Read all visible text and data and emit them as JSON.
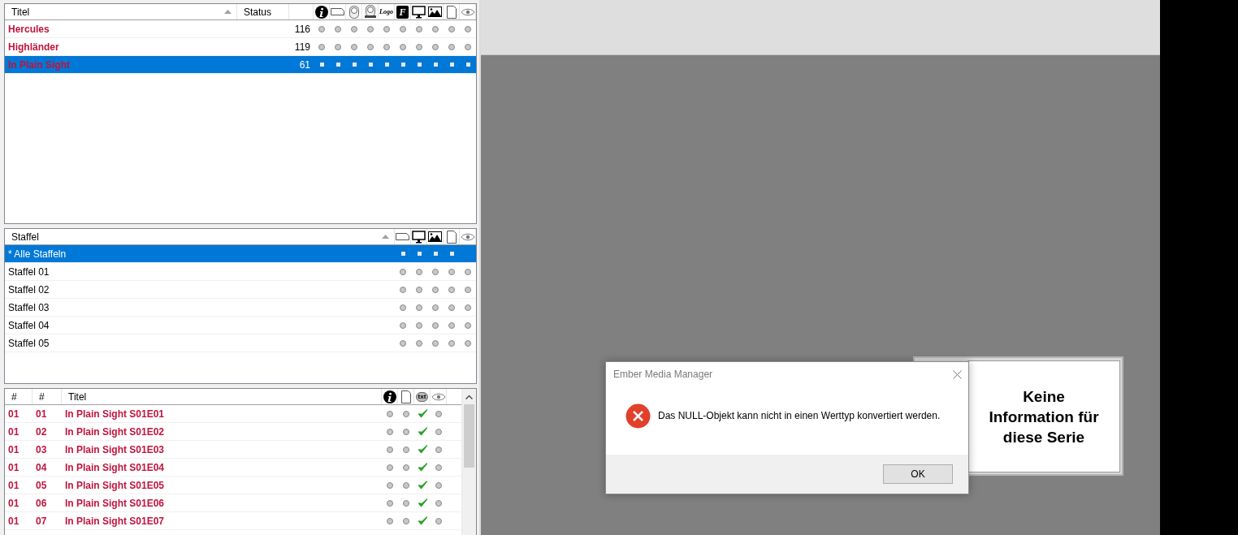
{
  "series_list": {
    "columns": [
      "Titel",
      "Status"
    ],
    "icon_headers": [
      {
        "kind": "info"
      },
      {
        "kind": "banner"
      },
      {
        "kind": "clearart"
      },
      {
        "kind": "clearlogo"
      },
      {
        "kind": "logo",
        "label": "Logo"
      },
      {
        "kind": "fanart",
        "label": "F"
      },
      {
        "kind": "monitor"
      },
      {
        "kind": "landscape"
      },
      {
        "kind": "document"
      },
      {
        "kind": "eye"
      }
    ],
    "rows": [
      {
        "title": "Hercules",
        "count": "116",
        "selected": false,
        "flags": [
          false,
          false,
          false,
          false,
          false,
          false,
          false,
          false,
          false,
          false
        ]
      },
      {
        "title": "Highländer",
        "count": "119",
        "selected": false,
        "flags": [
          false,
          false,
          false,
          false,
          false,
          false,
          false,
          false,
          false,
          false
        ]
      },
      {
        "title": "In Plain Sight",
        "count": "61",
        "selected": true,
        "flags": [
          false,
          false,
          false,
          false,
          false,
          false,
          false,
          false,
          false,
          false
        ]
      }
    ]
  },
  "season_list": {
    "columns": [
      "Staffel"
    ],
    "icon_headers": [
      {
        "kind": "banner"
      },
      {
        "kind": "monitor"
      },
      {
        "kind": "landscape"
      },
      {
        "kind": "document"
      },
      {
        "kind": "eye"
      }
    ],
    "rows": [
      {
        "label": "* Alle Staffeln",
        "selected": true,
        "flags": [
          false,
          false,
          false,
          false
        ]
      },
      {
        "label": "Staffel 01",
        "selected": false,
        "flags": [
          false,
          false,
          false,
          false,
          false
        ]
      },
      {
        "label": "Staffel 02",
        "selected": false,
        "flags": [
          false,
          false,
          false,
          false,
          false
        ]
      },
      {
        "label": "Staffel 03",
        "selected": false,
        "flags": [
          false,
          false,
          false,
          false,
          false
        ]
      },
      {
        "label": "Staffel 04",
        "selected": false,
        "flags": [
          false,
          false,
          false,
          false,
          false
        ]
      },
      {
        "label": "Staffel 05",
        "selected": false,
        "flags": [
          false,
          false,
          false,
          false,
          false
        ]
      }
    ]
  },
  "episode_list": {
    "columns": [
      "#",
      "#",
      "Titel"
    ],
    "icon_headers": [
      {
        "kind": "info"
      },
      {
        "kind": "document"
      },
      {
        "kind": "subtitle",
        "label": "txt"
      },
      {
        "kind": "eye"
      }
    ],
    "rows": [
      {
        "season": "01",
        "episode": "01",
        "title": "In Plain Sight S01E01",
        "flags": [
          false,
          false,
          true,
          false
        ]
      },
      {
        "season": "01",
        "episode": "02",
        "title": "In Plain Sight S01E02",
        "flags": [
          false,
          false,
          true,
          false
        ]
      },
      {
        "season": "01",
        "episode": "03",
        "title": "In Plain Sight S01E03",
        "flags": [
          false,
          false,
          true,
          false
        ]
      },
      {
        "season": "01",
        "episode": "04",
        "title": "In Plain Sight S01E04",
        "flags": [
          false,
          false,
          true,
          false
        ]
      },
      {
        "season": "01",
        "episode": "05",
        "title": "In Plain Sight S01E05",
        "flags": [
          false,
          false,
          true,
          false
        ]
      },
      {
        "season": "01",
        "episode": "06",
        "title": "In Plain Sight S01E06",
        "flags": [
          false,
          false,
          true,
          false
        ]
      },
      {
        "season": "01",
        "episode": "07",
        "title": "In Plain Sight S01E07",
        "flags": [
          false,
          false,
          true,
          false
        ]
      }
    ]
  },
  "info_panel": {
    "message": "Keine Information für diese Serie"
  },
  "dialog": {
    "title": "Ember Media Manager",
    "message": "Das NULL-Objekt kann nicht in einen Werttyp konvertiert werden.",
    "button": "OK"
  }
}
